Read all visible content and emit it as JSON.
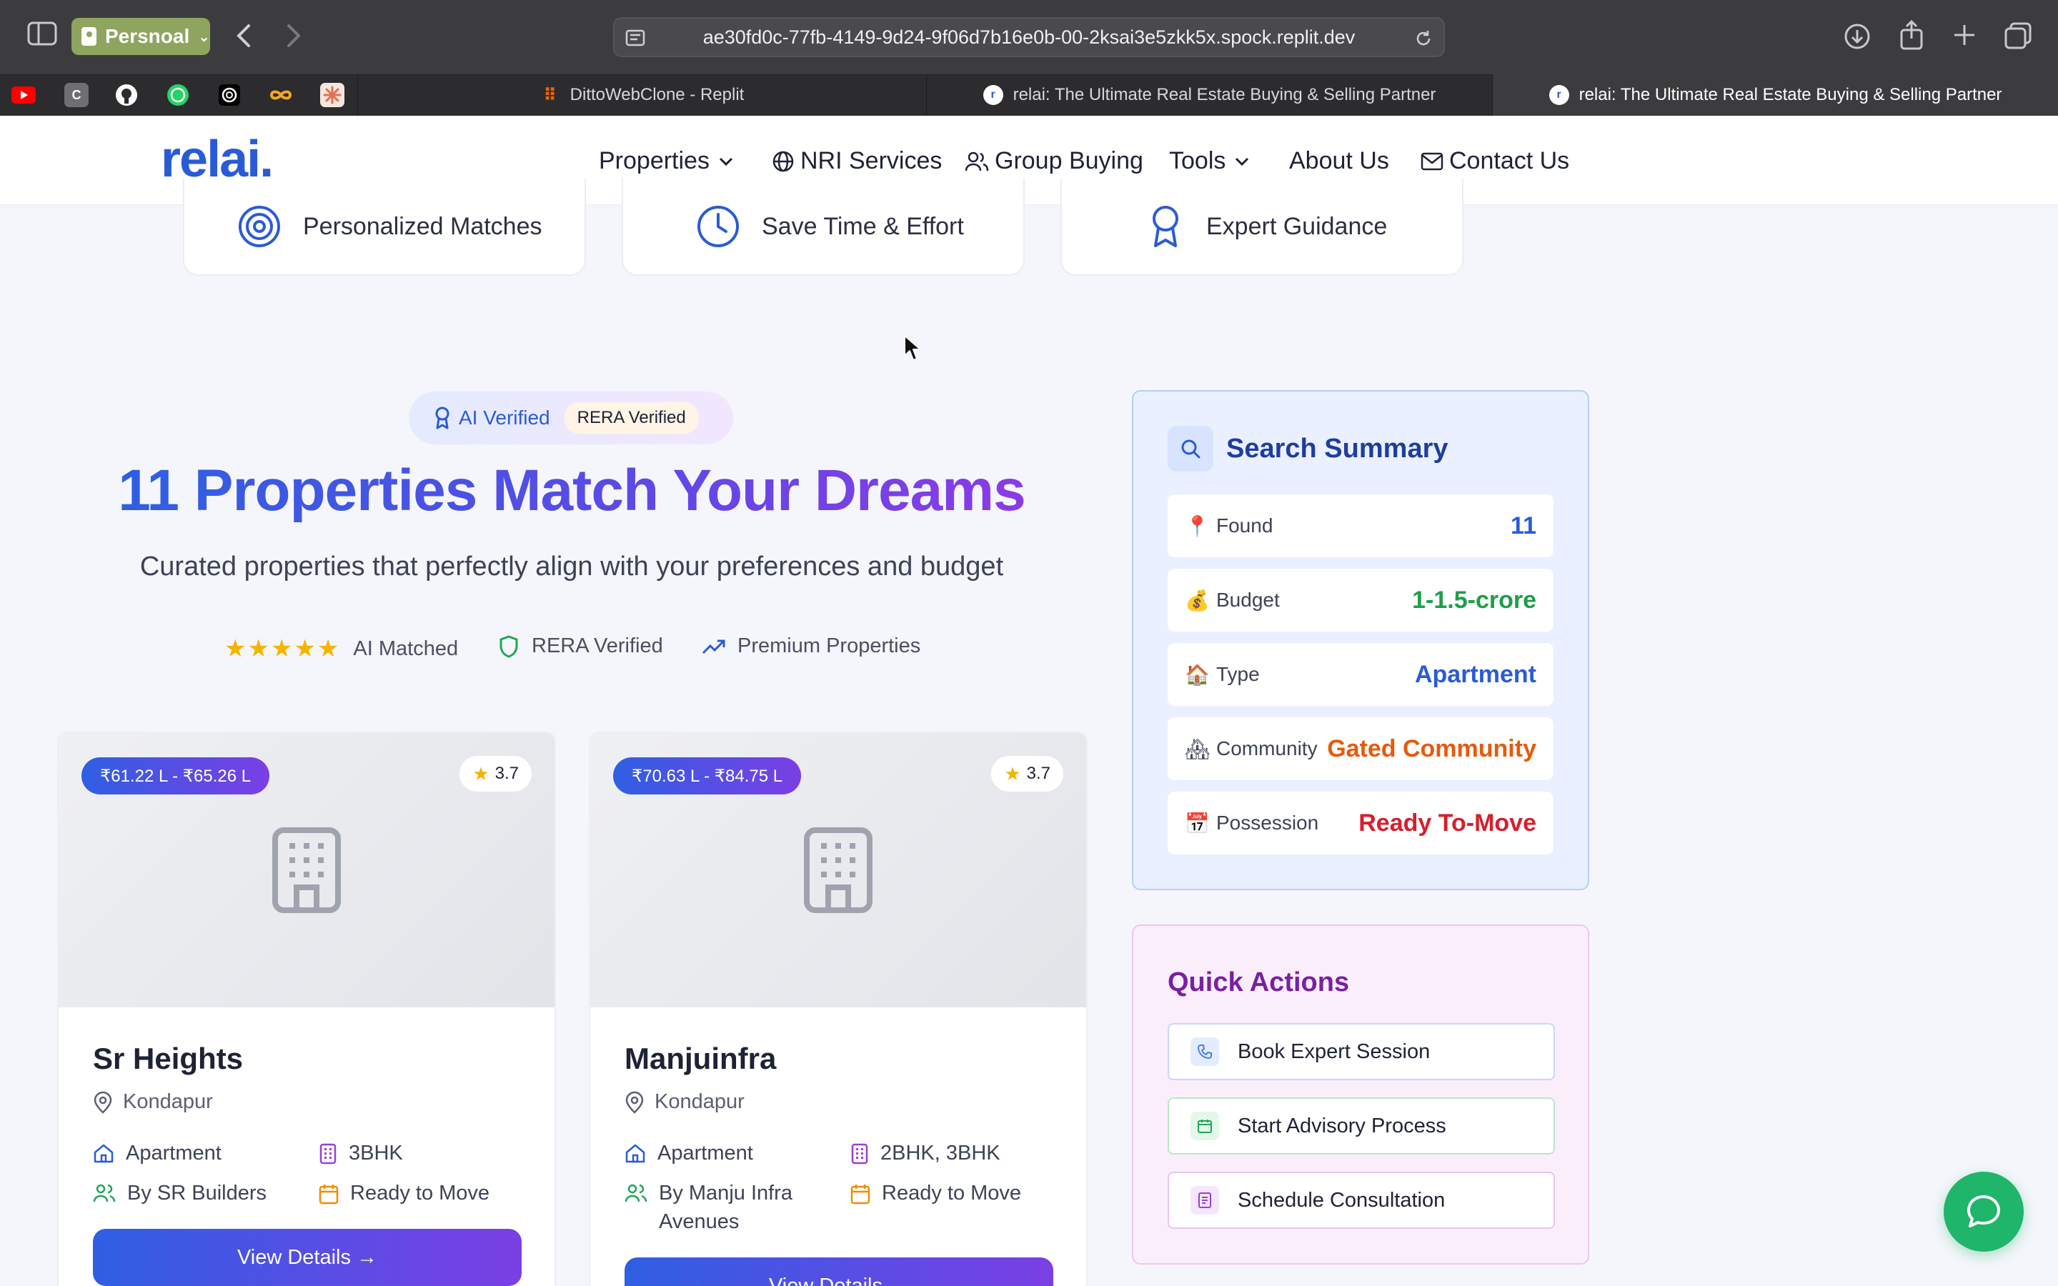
{
  "browser": {
    "profile_label": "Persnoal",
    "url": "ae30fd0c-77fb-4149-9d24-9f06d7b16e0b-00-2ksai3e5zkk5x.spock.replit.dev",
    "tabs": [
      {
        "label": "DittoWebClone - Replit"
      },
      {
        "label": "relai: The Ultimate Real Estate Buying & Selling Partner"
      },
      {
        "label": "relai: The Ultimate Real Estate Buying & Selling Partner"
      }
    ],
    "pinned_favicons": [
      {
        "icon": "youtube-icon",
        "color": "#ff0000"
      },
      {
        "icon": "c-app-icon",
        "color": "#6e6e73",
        "glyph": "C"
      },
      {
        "icon": "github-icon",
        "color": "#ffffff"
      },
      {
        "icon": "whatsapp-icon",
        "color": "#25d366"
      },
      {
        "icon": "openai-icon",
        "color": "#ffffff"
      },
      {
        "icon": "infinity-icon",
        "color": "#f5a623"
      },
      {
        "icon": "claude-icon",
        "color": "#e2704f"
      }
    ]
  },
  "site": {
    "logo": "relai.",
    "nav": {
      "properties": "Properties",
      "nri": "NRI Services",
      "group": "Group Buying",
      "tools": "Tools",
      "about": "About Us",
      "contact": "Contact Us"
    },
    "features": [
      {
        "label": "Personalized Matches",
        "icon": "target-icon"
      },
      {
        "label": "Save Time & Effort",
        "icon": "clock-icon"
      },
      {
        "label": "Expert Guidance",
        "icon": "award-icon"
      }
    ]
  },
  "hero": {
    "badge_ai": "AI Verified",
    "badge_rera": "RERA Verified",
    "title": "11 Properties Match Your Dreams",
    "subtitle": "Curated properties that perfectly align with your preferences and budget",
    "trust": {
      "stars": "★★★★★",
      "ai_matched": "AI Matched",
      "rera": "RERA Verified",
      "premium": "Premium Properties"
    }
  },
  "properties": [
    {
      "price": "₹61.22 L - ₹65.26 L",
      "rating": "3.7",
      "name": "Sr Heights",
      "location": "Kondapur",
      "type": "Apartment",
      "config": "3BHK",
      "builder": "By SR Builders",
      "status": "Ready to Move",
      "cta": "View Details →"
    },
    {
      "price": "₹70.63 L - ₹84.75 L",
      "rating": "3.7",
      "name": "Manjuinfra",
      "location": "Kondapur",
      "type": "Apartment",
      "config": "2BHK, 3BHK",
      "builder": "By Manju Infra Avenues",
      "status": "Ready to Move",
      "cta": "View Details →"
    }
  ],
  "summary": {
    "title": "Search Summary",
    "rows": [
      {
        "emoji": "📍",
        "label": "Found",
        "value": "11",
        "color": "#2a5bd7"
      },
      {
        "emoji": "💰",
        "label": "Budget",
        "value": "1-1.5-crore",
        "color": "#1e9e4a"
      },
      {
        "emoji": "🏠",
        "label": "Type",
        "value": "Apartment",
        "color": "#2a5bd7"
      },
      {
        "emoji": "🏘",
        "label": "Community",
        "value": "Gated Community",
        "color": "#e8590c"
      },
      {
        "emoji": "📅",
        "label": "Possession",
        "value": "Ready To-Move",
        "color": "#d61f2c"
      }
    ]
  },
  "quick_actions": {
    "title": "Quick Actions",
    "items": [
      {
        "label": "Book Expert Session",
        "icon": "phone-icon",
        "accent": "#4b7cf0"
      },
      {
        "label": "Start Advisory Process",
        "icon": "calendar-icon",
        "accent": "#22a557"
      },
      {
        "label": "Schedule Consultation",
        "icon": "document-icon",
        "accent": "#9b3fd6"
      }
    ]
  }
}
